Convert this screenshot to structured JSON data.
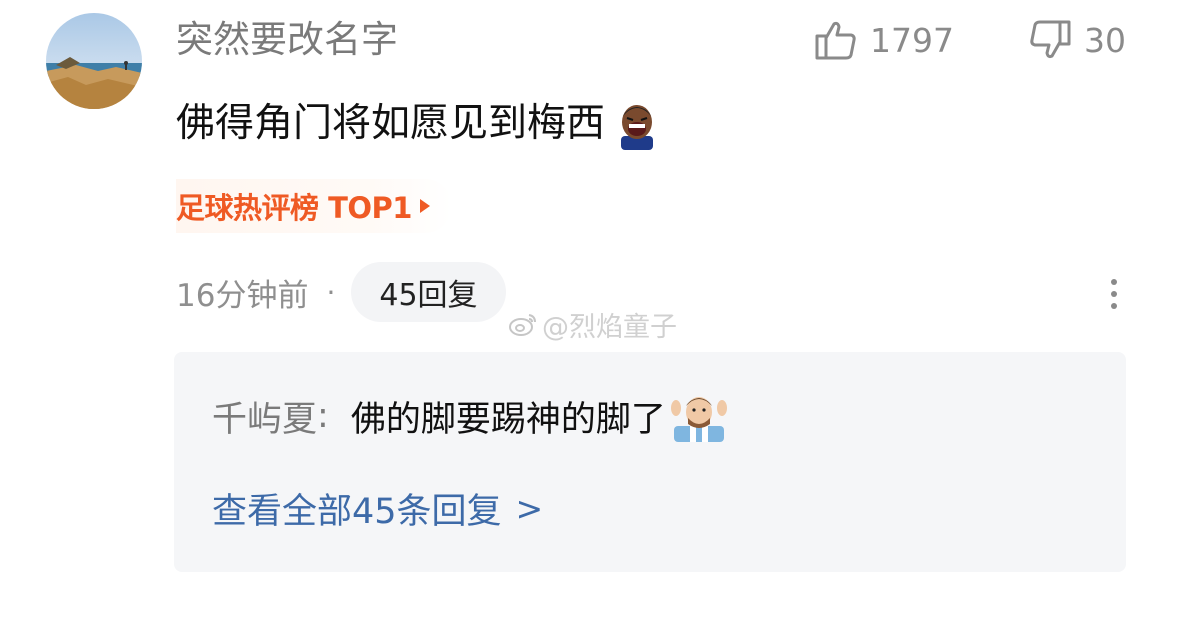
{
  "comment": {
    "username": "突然要改名字",
    "text": "佛得角门将如愿见到梅西",
    "emoji": "mbappe-laughing-emoji",
    "like_count": "1797",
    "dislike_count": "30",
    "rank_badge": "足球热评榜 TOP1",
    "time": "16分钟前",
    "dot": "·",
    "reply_count_label": "45回复"
  },
  "watermark": {
    "text": "@烈焰童子"
  },
  "reply_preview": {
    "author": "千屿夏",
    "separator": ":",
    "content": "佛的脚要踢神的脚了",
    "emoji": "messi-emoji",
    "view_all_label": "查看全部45条回复",
    "view_all_chevron": ">"
  },
  "colors": {
    "accent_orange": "#ef5a24",
    "link_blue": "#3d6aa8",
    "muted_gray": "#8f8f8f",
    "reply_bg": "#f5f6f8"
  },
  "icons": [
    "thumbs-up-icon",
    "thumbs-down-icon",
    "more-vertical-icon",
    "weibo-icon"
  ]
}
